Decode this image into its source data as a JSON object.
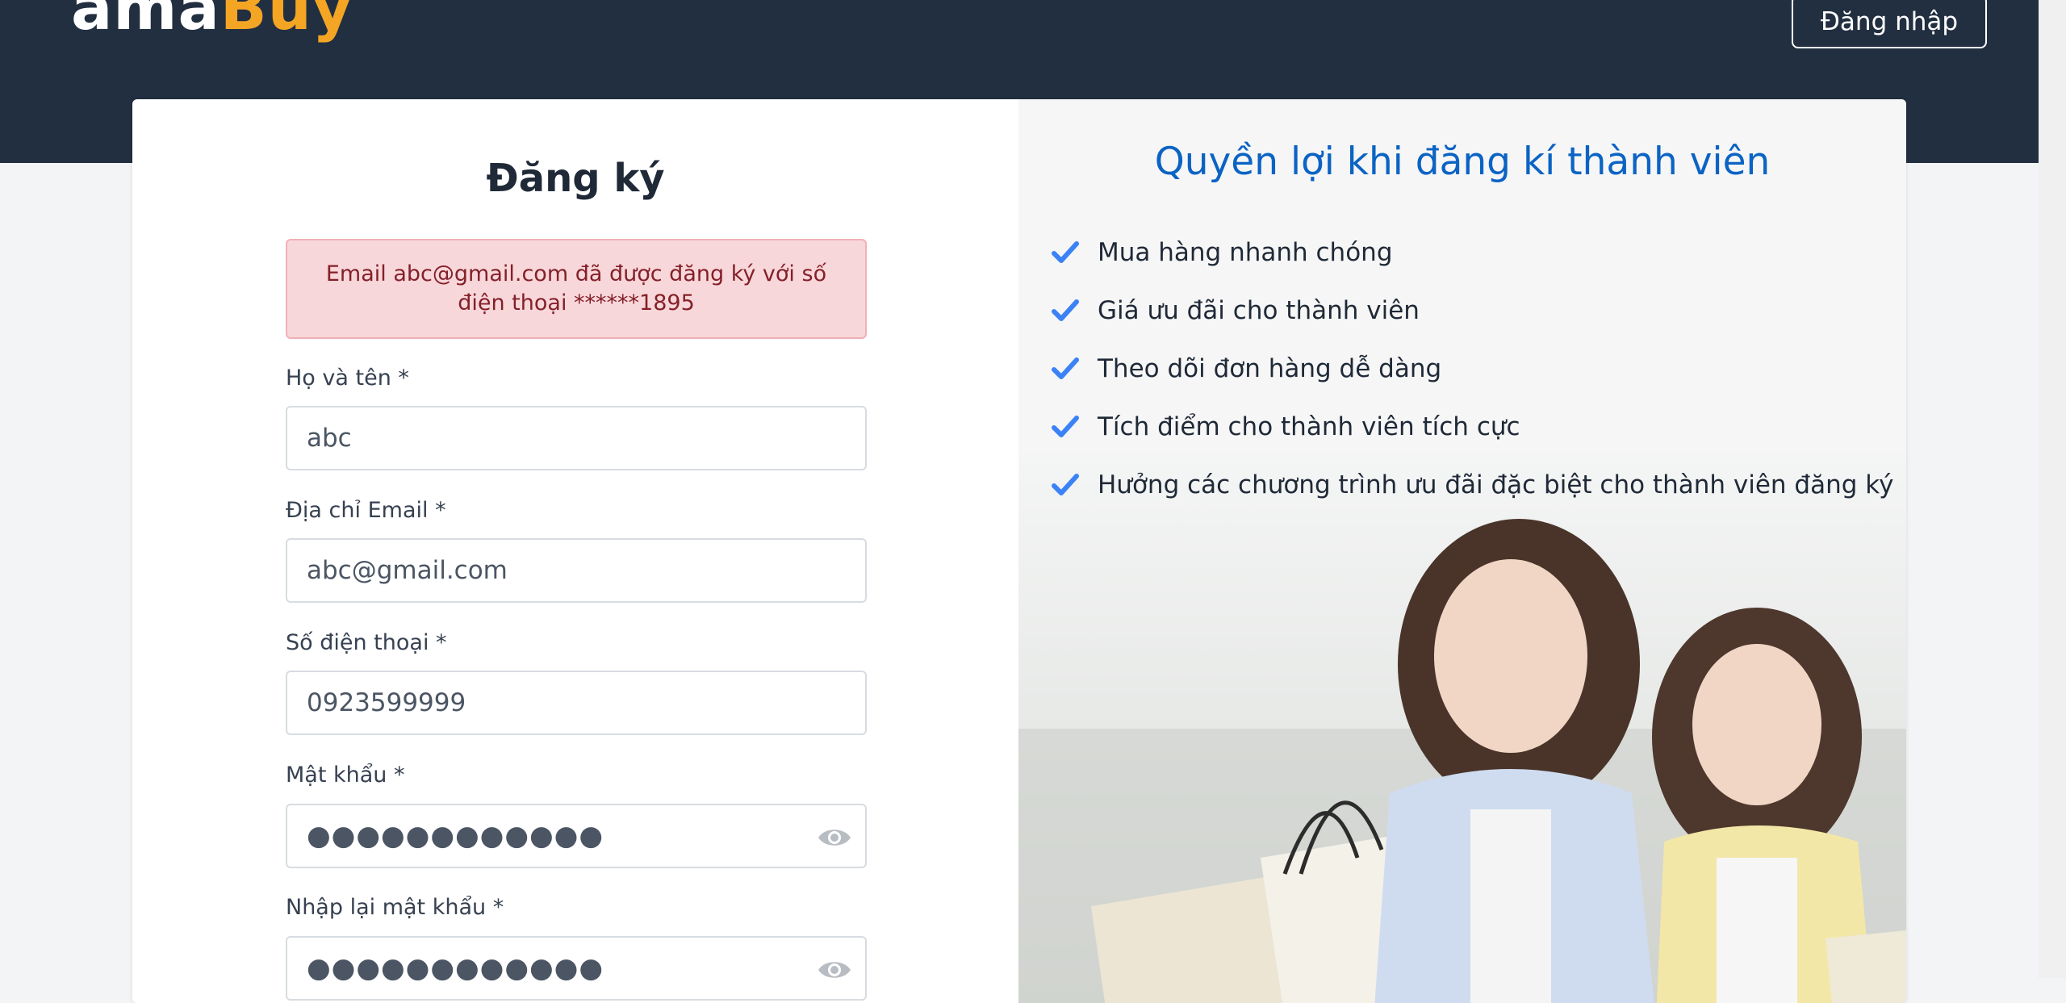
{
  "header": {
    "logo_part1": "ama",
    "logo_part2": "Buy",
    "login_label": "Đăng nhập",
    "bg_color": "#222f41",
    "logo_accent": "#f5a524"
  },
  "form": {
    "title": "Đăng ký",
    "alert": "Email abc@gmail.com đã được đăng ký với số điện thoại ******1895",
    "fields": {
      "name": {
        "label": "Họ và tên *",
        "value": "abc"
      },
      "email": {
        "label": "Địa chỉ Email *",
        "value": "abc@gmail.com"
      },
      "phone": {
        "label": "Số điện thoại *",
        "value": "0923599999"
      },
      "password": {
        "label": "Mật khẩu *",
        "value": "●●●●●●●●●●●●"
      },
      "confirm": {
        "label": "Nhập lại mật khẩu *",
        "value": "●●●●●●●●●●●●"
      }
    }
  },
  "benefits": {
    "title": "Quyền lợi khi đăng kí thành viên",
    "items": [
      "Mua hàng nhanh chóng",
      "Giá ưu đãi cho thành viên",
      "Theo dõi đơn hàng dễ dàng",
      "Tích điểm cho thành viên tích cực",
      "Hưởng các chương trình ưu đãi đặc biệt cho thành viên đăng ký"
    ],
    "check_color": "#3b82f6",
    "title_color": "#0b63c4"
  }
}
